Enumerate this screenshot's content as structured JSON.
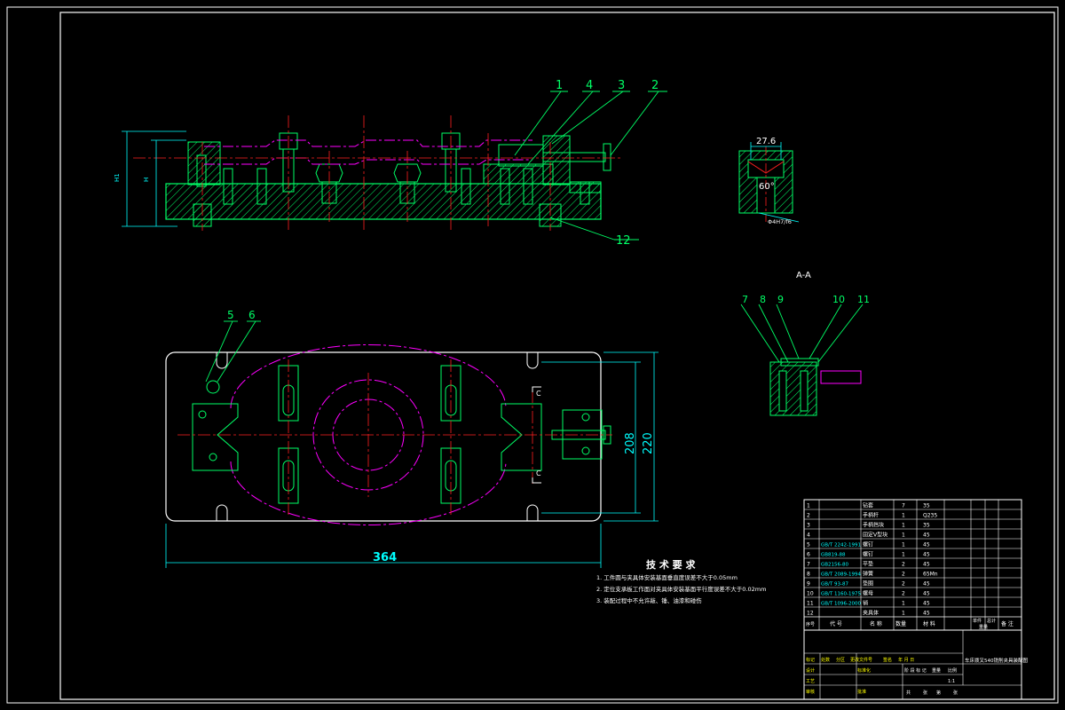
{
  "colors": {
    "background": "#000000",
    "frame": "#ffffff",
    "outline": "#00ff66",
    "dimension": "#00ffff",
    "centerline": "#ff2020",
    "phantom": "#ff00ff",
    "hatch": "#00ff66",
    "text": "#ffffff",
    "title_yellow": "#ffff00"
  },
  "balloons_top": [
    "1",
    "4",
    "3",
    "2",
    "12"
  ],
  "balloons_plan": [
    "5",
    "6"
  ],
  "balloons_section": [
    "7",
    "8",
    "9",
    "10",
    "11"
  ],
  "dims": {
    "length": "364",
    "width_outer": "220",
    "width_inner": "208",
    "height_1": "H1",
    "height_2": "H",
    "detail_width": "27.6",
    "detail_angle": "60°",
    "fit": "Φ4H7/f6"
  },
  "section_label": "A-A",
  "cut_marks": [
    "C",
    "C"
  ],
  "tech_req": {
    "title": "技 术 要 求",
    "items": [
      "1. 工件圆与夹具体安装基面垂直度误差不大于0.05mm",
      "2. 定位支承板工作面对夹具体安装基面平行度误差不大于0.02mm",
      "3. 装配过程中不允许敲、锤、油漆和碰伤"
    ]
  },
  "bom": {
    "rows": [
      {
        "no": "1",
        "name": "钻套",
        "std": "",
        "qty": "7",
        "mat": "35"
      },
      {
        "no": "2",
        "name": "手柄杆",
        "std": "",
        "qty": "1",
        "mat": "Q235"
      },
      {
        "no": "3",
        "name": "手柄挡块",
        "std": "",
        "qty": "1",
        "mat": "35"
      },
      {
        "no": "4",
        "name": "固定V型块",
        "std": "",
        "qty": "1",
        "mat": "45"
      },
      {
        "no": "5",
        "name": "螺钉",
        "std": "GB/T 2242-1991",
        "qty": "1",
        "mat": "45"
      },
      {
        "no": "6",
        "name": "螺钉",
        "std": "GB819-88",
        "qty": "1",
        "mat": "45"
      },
      {
        "no": "7",
        "name": "平垫",
        "std": "GB2156-80",
        "qty": "2",
        "mat": "45"
      },
      {
        "no": "8",
        "name": "弹簧",
        "std": "GB/T 2089-1994",
        "qty": "2",
        "mat": "65Mn"
      },
      {
        "no": "9",
        "name": "垫圈",
        "std": "GB/T 93-87",
        "qty": "2",
        "mat": "45"
      },
      {
        "no": "10",
        "name": "螺母",
        "std": "GB/T 1160-1975",
        "qty": "2",
        "mat": "45"
      },
      {
        "no": "11",
        "name": "销",
        "std": "GB/T 1096-2000",
        "qty": "1",
        "mat": "45"
      },
      {
        "no": "12",
        "name": "夹具体",
        "std": "",
        "qty": "1",
        "mat": "45"
      }
    ],
    "header": {
      "no": "序号",
      "std": "代 号",
      "name": "名 称",
      "qty": "数量",
      "mat": "材 料",
      "unit_wt": "单件",
      "total_wt": "总计",
      "note": "备 注",
      "weight": "重量"
    }
  },
  "title_block": {
    "drawing_name": "车床拨叉540铣削夹具装配图",
    "marks": [
      "标记",
      "处数",
      "分区",
      "更改文件号",
      "签名",
      "年 月 日"
    ],
    "roles": [
      "设计",
      "审核",
      "工艺"
    ],
    "stage": [
      "阶 段 标 记",
      "重量",
      "比例"
    ],
    "scale": "1:1",
    "sheet": [
      "共",
      "张",
      "第",
      "张"
    ],
    "extra": [
      "标准化",
      "批准"
    ]
  }
}
